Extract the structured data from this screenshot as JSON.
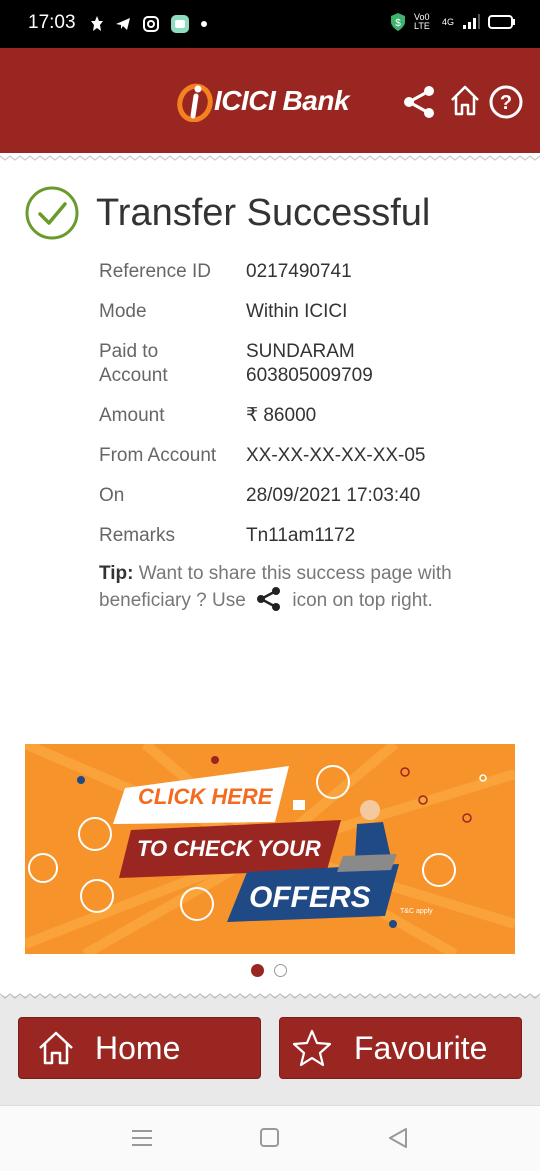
{
  "status_bar": {
    "time": "17:03",
    "network_label": "Vo0 LTE",
    "signal_label": "4G"
  },
  "header": {
    "logo_text": "ICICI Bank",
    "share_icon": "share-icon",
    "home_icon": "home-icon",
    "help_icon": "help-icon"
  },
  "result": {
    "title": "Transfer Successful",
    "check_icon": "check-circle-icon"
  },
  "details": [
    {
      "label": "Reference ID",
      "value": "0217490741"
    },
    {
      "label": "Mode",
      "value": "Within ICICI"
    },
    {
      "label": "Paid to\nAccount",
      "value": "SUNDARAM\n603805009709"
    },
    {
      "label": "Amount",
      "value": "₹ 86000"
    },
    {
      "label": "From Account",
      "value": "XX-XX-XX-XX-XX-05"
    },
    {
      "label": "On",
      "value": "28/09/2021 17:03:40"
    },
    {
      "label": "Remarks",
      "value": "Tn11am1172"
    }
  ],
  "tip": {
    "label": "Tip:",
    "text_before": "Want to share this success page with beneficiary ? Use",
    "text_after": "icon on top right."
  },
  "banner": {
    "line1": "CLICK HERE",
    "line2": "TO CHECK YOUR",
    "line3": "OFFERS",
    "fine_print": "T&C apply"
  },
  "carousel": {
    "active_index": 0,
    "count": 2
  },
  "footer": {
    "home_label": "Home",
    "favourite_label": "Favourite"
  },
  "colors": {
    "brand_red": "#9a2622",
    "success_green": "#6a9a2b",
    "banner_orange": "#f7932b",
    "banner_blue": "#1f4a86"
  }
}
